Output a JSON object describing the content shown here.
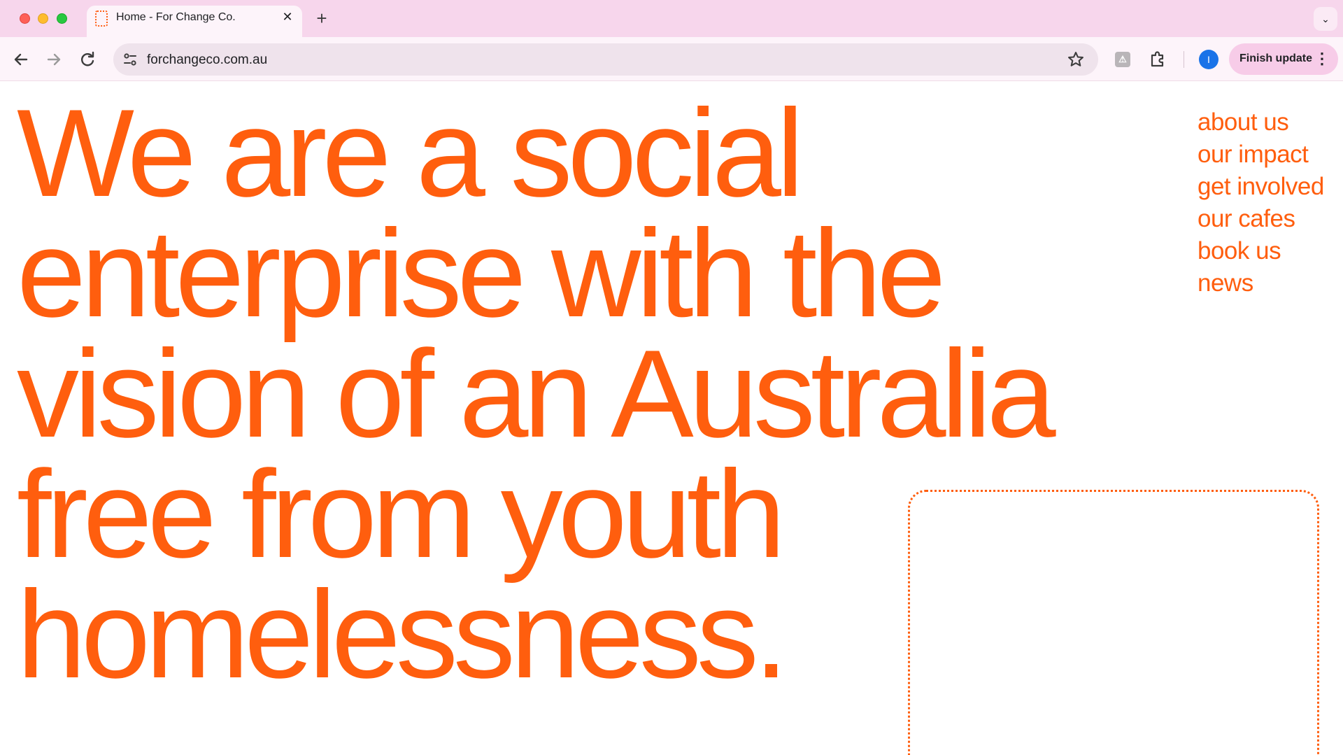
{
  "browser": {
    "tab_title": "Home - For Change Co.",
    "tab_close": "✕",
    "new_tab": "+",
    "tab_menu": "⌄",
    "url": "forchangeco.com.au",
    "profile_initial": "I",
    "finish_update_label": "Finish update",
    "extension_label": "⚠"
  },
  "hero": {
    "lines": [
      "We are a social",
      "enterprise with the",
      "vision of an Australia",
      "free from youth",
      "homelessness."
    ]
  },
  "nav": {
    "items": [
      "about us",
      "our impact",
      "get involved",
      "our cafes",
      "book us",
      "news"
    ]
  },
  "colors": {
    "brand_orange": "#ff5e0e",
    "tabbar_pink": "#f7d6ec",
    "toolbar_pink": "#fdf4fa"
  },
  "icons": {
    "back": "arrow-left-icon",
    "forward": "arrow-right-icon",
    "reload": "reload-icon",
    "site_info": "tune-icon",
    "bookmark": "star-icon",
    "extensions": "puzzle-icon",
    "menu": "kebab-icon"
  }
}
